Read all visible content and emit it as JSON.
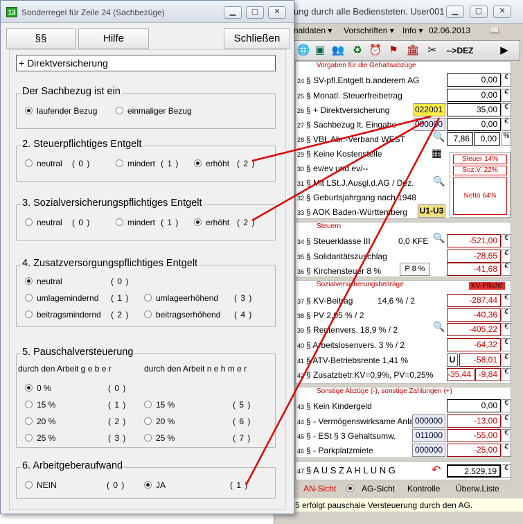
{
  "bg_window": {
    "title": "ung durch alle Bediensteten.   User001",
    "menu": [
      "naldaten ▾",
      "Vorschriften ▾",
      "Info ▾",
      "02.06.2013"
    ],
    "toolbar_dez": "-->DEZ",
    "sections": {
      "vorgaben_title": "Vorgaben für die Gehaltsabzüge",
      "steuern_title": "Steuern",
      "sv_title": "Sozialversicherungsbeiträge",
      "kv_pflicht": "KV-Pflicht!",
      "sonstige_title": "Sonstige Abzüge (-), sonstige Zahlungen (+)"
    },
    "rows": {
      "r24": {
        "nr": "24",
        "label": "§ SV-pfl.Entgelt b.anderem AG",
        "value": "0,00"
      },
      "r25": {
        "nr": "25",
        "label": "§ Monatl. Steuerfreibetrag",
        "value": "0,00"
      },
      "r26": {
        "nr": "26",
        "label": "§ + Direktversicherung",
        "code": "022001",
        "value": "35,00"
      },
      "r27": {
        "nr": "27",
        "label": "§ Sachbezug lt. Eingabe",
        "code": "000000",
        "value": "0,00"
      },
      "r28": {
        "nr": "28",
        "label": "§ VBL Abr.-Verband WEST",
        "value1": "7,86",
        "value2": "0,00",
        "unit": "%"
      },
      "r29": {
        "nr": "29",
        "label": "§ Keine Kostenstelle"
      },
      "r30": {
        "nr": "30",
        "label": "§ ev/ev und ev/--"
      },
      "r31": {
        "nr": "31",
        "label": "§ Mit LSt.J.Ausgl.d.AG / Dez."
      },
      "r32": {
        "nr": "32",
        "label": "§ Geburtsjahrgang nach 1948"
      },
      "r33": {
        "nr": "33",
        "label": "§ AOK Baden-Württemberg",
        "badge": "U1-U3"
      },
      "r34": {
        "nr": "34",
        "label": "§ Steuerklasse  III",
        "extra": "0,0 KFE",
        "value": "-521,00"
      },
      "r35": {
        "nr": "35",
        "label": "§ Solidaritätszuschlag",
        "value": "-28,65"
      },
      "r36": {
        "nr": "36",
        "label": "§ Kirchensteuer 8 %",
        "badge": "P 8 %",
        "value": "-41,68"
      },
      "r37": {
        "nr": "37",
        "label": "§ KV-Beitrag",
        "extra": "14,6 % / 2",
        "value": "-287,44"
      },
      "r38": {
        "nr": "38",
        "label": "§ PV 2,05 % / 2",
        "value": "-40,36"
      },
      "r39": {
        "nr": "39",
        "label": "§ Rentenvers. 18,9 % / 2",
        "value": "-405,22"
      },
      "r40": {
        "nr": "40",
        "label": "§ Arbeitslosenvers. 3 % / 2",
        "value": "-64,32"
      },
      "r41": {
        "nr": "41",
        "label": "§ ATV-Betriebsrente 1,41 %",
        "badge": "U",
        "value": "-58,01"
      },
      "r42": {
        "nr": "42",
        "label": "§ Zusatzbetr.KV=0,9%, PV=0,25%",
        "value1": "-35,44",
        "value2": "-9,84"
      },
      "r43": {
        "nr": "43",
        "label": "§ Kein Kindergeld",
        "value": "0,00"
      },
      "r44": {
        "nr": "44",
        "label": "§ - Vermögenswirksame Anlage",
        "code": "000000",
        "value": "-13,00"
      },
      "r45": {
        "nr": "45",
        "label": "§ - ESt § 3 Gehaltsumw.",
        "code": "011000",
        "value": "-55,00"
      },
      "r46": {
        "nr": "46",
        "label": "§ - Parkplatzmiete",
        "code": "000000",
        "value": "-25,00"
      },
      "r47": {
        "nr": "47",
        "label": "§ A U S Z A H L U N G",
        "value": "2.529,19"
      }
    },
    "ratio": {
      "steuer": "Steuer 14%",
      "sozv": "Soz.V. 22%",
      "netto": "Netto  64%"
    },
    "bottom": {
      "an_sicht": "AN-Sicht",
      "ag_sicht": "AG-Sicht",
      "kontrolle": "Kontrolle",
      "ueberw": "Überw.Liste"
    },
    "status": "5 erfolgt pauschale Versteuerung durch den AG.",
    "euro": "€"
  },
  "dialog": {
    "icon_label": "13",
    "title": "Sonderregel für Zeile 24 (Sachbezüge)",
    "buttons": {
      "paragraphs": "§§",
      "help": "Hilfe",
      "close": "Schließen"
    },
    "headline": "+ Direktversicherung",
    "g1": {
      "title": "Der Sachbezug ist ein",
      "opt1": "laufender Bezug",
      "opt2": "einmaliger Bezug"
    },
    "g2": {
      "title": "2. Steuerpflichtiges Entgelt",
      "neutral": "neutral",
      "n0": "( 0 )",
      "mindert": "mindert",
      "n1": "( 1 )",
      "erhoeht": "erhöht",
      "n2": "( 2 )"
    },
    "g3": {
      "title": "3. Sozialversicherungspflichtiges Entgelt",
      "neutral": "neutral",
      "n0": "( 0 )",
      "mindert": "mindert",
      "n1": "( 1 )",
      "erhoeht": "erhöht",
      "n2": "( 2 )"
    },
    "g4": {
      "title": "4. Zusatzversorgungspflichtiges Entgelt",
      "neutral": "neutral",
      "n0": "( 0 )",
      "umlmin": "umlagemindernd",
      "n1": "( 1 )",
      "umlerh": "umlageerhöhend",
      "n3": "( 3 )",
      "beitrmin": "beitragsmindernd",
      "n2": "( 2 )",
      "beitrerh": "beitragserhöhend",
      "n4": "( 4 )"
    },
    "g5": {
      "title": "5. Pauschalversteuerung",
      "geber": "durch den Arbeit   g e b e r",
      "nehmer": "durch den Arbeit   n e h m e r",
      "p0": "0 %",
      "n0": "( 0 )",
      "p15a": "15 %",
      "n1": "( 1 )",
      "p15b": "15 %",
      "n5": "( 5 )",
      "p20a": "20 %",
      "n2": "( 2 )",
      "p20b": "20 %",
      "n6": "( 6 )",
      "p25a": "25 %",
      "n3": "( 3 )",
      "p25b": "25 %",
      "n7": "( 7 )"
    },
    "g6": {
      "title": "6. Arbeitgeberaufwand",
      "nein": "NEIN",
      "n0": "( 0 )",
      "ja": "JA",
      "n1": "( 1 )"
    }
  }
}
